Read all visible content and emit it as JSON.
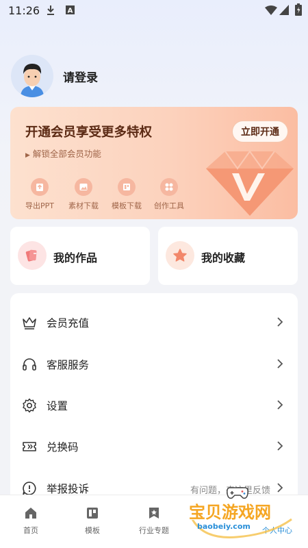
{
  "status_bar": {
    "time": "11:26"
  },
  "profile": {
    "login_text": "请登录"
  },
  "vip": {
    "title": "开通会员享受更多特权",
    "subtitle": "解锁全部会员功能",
    "open_button": "立即开通",
    "features": [
      {
        "label": "导出PPT",
        "icon": "export-icon"
      },
      {
        "label": "素材下载",
        "icon": "image-icon"
      },
      {
        "label": "模板下载",
        "icon": "template-icon"
      },
      {
        "label": "创作工具",
        "icon": "tools-icon"
      }
    ]
  },
  "shortcuts": [
    {
      "label": "我的作品",
      "icon": "works-icon",
      "color": "#fde4e4"
    },
    {
      "label": "我的收藏",
      "icon": "star-icon",
      "color": "#fde8df"
    }
  ],
  "menu": [
    {
      "label": "会员充值",
      "icon": "crown-icon",
      "extra": ""
    },
    {
      "label": "客服服务",
      "icon": "headset-icon",
      "extra": ""
    },
    {
      "label": "设置",
      "icon": "gear-icon",
      "extra": ""
    },
    {
      "label": "兑换码",
      "icon": "ticket-icon",
      "extra": ""
    },
    {
      "label": "举报投诉",
      "icon": "report-icon",
      "extra": "有问题，来这里反馈"
    }
  ],
  "bottom_nav": [
    {
      "label": "首页",
      "icon": "home-icon"
    },
    {
      "label": "模板",
      "icon": "template-icon"
    },
    {
      "label": "行业专题",
      "icon": "bookmark-icon"
    },
    {
      "label": "个人中心",
      "icon": "user-icon"
    }
  ],
  "watermark": {
    "text": "宝贝游戏网",
    "url": "baobeiy.com"
  },
  "colors": {
    "accent": "#5b2a14",
    "vip_bg": "#fcd2bd",
    "watermark": "#f5a623"
  }
}
